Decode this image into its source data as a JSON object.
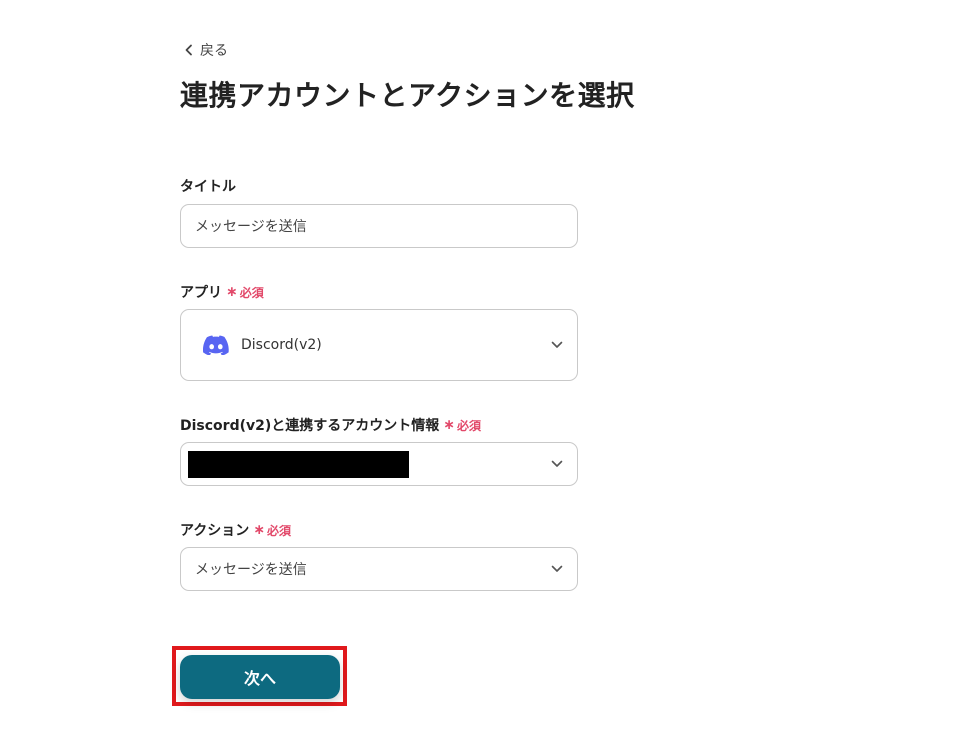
{
  "header": {
    "back_label": "戻る",
    "title": "連携アカウントとアクションを選択"
  },
  "form": {
    "title_field": {
      "label": "タイトル",
      "value": "メッセージを送信"
    },
    "app_field": {
      "label": "アプリ",
      "required": "必須",
      "value": "Discord(v2)",
      "icon": "discord-icon"
    },
    "account_field": {
      "label": "Discord(v2)と連携するアカウント情報",
      "required": "必須",
      "value_redacted": true
    },
    "action_field": {
      "label": "アクション",
      "required": "必須",
      "value": "メッセージを送信"
    }
  },
  "footer": {
    "next_label": "次へ"
  },
  "colors": {
    "primary_button": "#0d6a80",
    "required_text": "#e2496a",
    "highlight_frame": "#e0191c",
    "discord_brand": "#5865f2"
  }
}
